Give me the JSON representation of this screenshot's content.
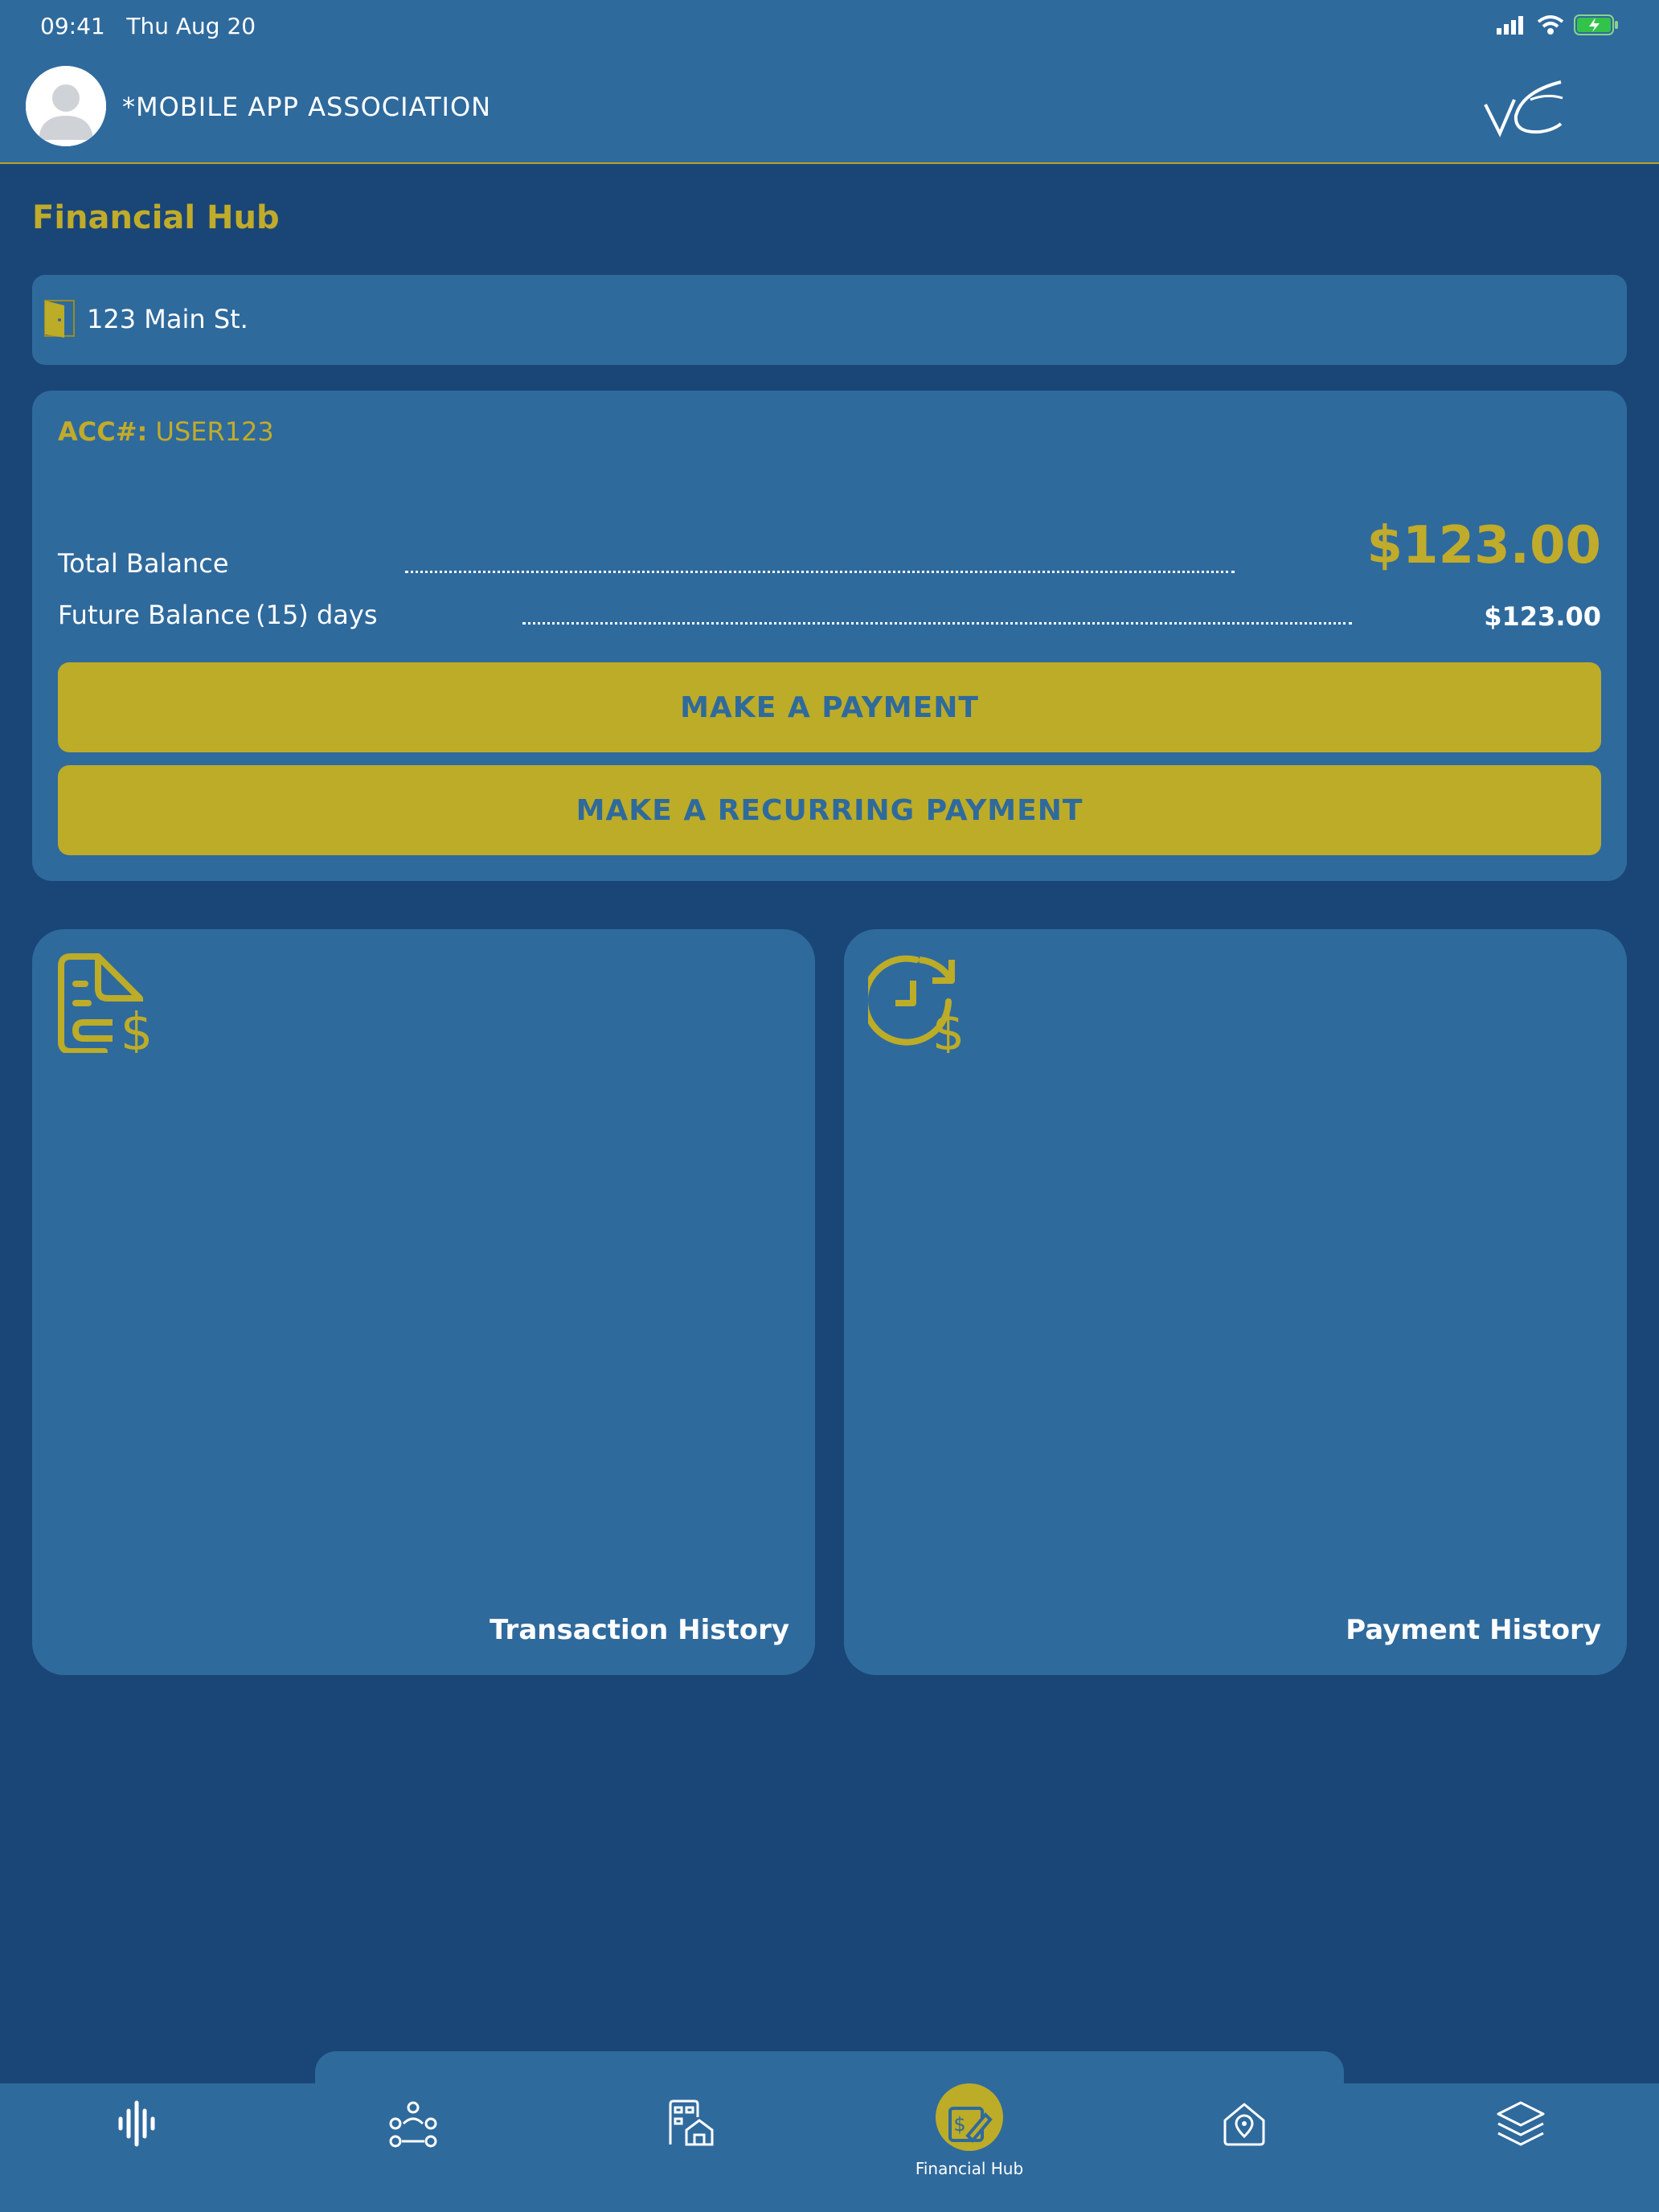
{
  "status_bar": {
    "time": "09:41",
    "date": "Thu Aug 20"
  },
  "header": {
    "organization": "*MOBILE APP ASSOCIATION",
    "logo_icon": "vc-logo"
  },
  "page": {
    "title": "Financial Hub"
  },
  "address": {
    "text": "123 Main St.",
    "icon": "door-icon"
  },
  "account": {
    "acc_prefix": "ACC#:",
    "acc_number": "USER123",
    "total_balance_label": "Total Balance",
    "total_balance_value": "$123.00",
    "future_balance_label": "Future Balance (15) days",
    "future_balance_value": "$123.00"
  },
  "buttons": {
    "make_payment": "MAKE A PAYMENT",
    "make_recurring_payment": "MAKE A RECURRING PAYMENT"
  },
  "tiles": [
    {
      "label": "Transaction History",
      "icon": "invoice-dollar-icon"
    },
    {
      "label": "Payment History",
      "icon": "clock-dollar-icon"
    }
  ],
  "nav": {
    "active_label": "Financial Hub",
    "items": [
      {
        "icon": "soundwave-icon"
      },
      {
        "icon": "community-icon"
      },
      {
        "icon": "buildings-icon"
      },
      {
        "icon": "financial-hub-icon",
        "label": "Financial Hub",
        "active": true
      },
      {
        "icon": "home-location-icon"
      },
      {
        "icon": "layers-icon"
      }
    ]
  },
  "colors": {
    "background": "#1a4677",
    "panel": "#2f6a9d",
    "accent": "#bcac27",
    "accent_text": "#c0ab2a"
  }
}
